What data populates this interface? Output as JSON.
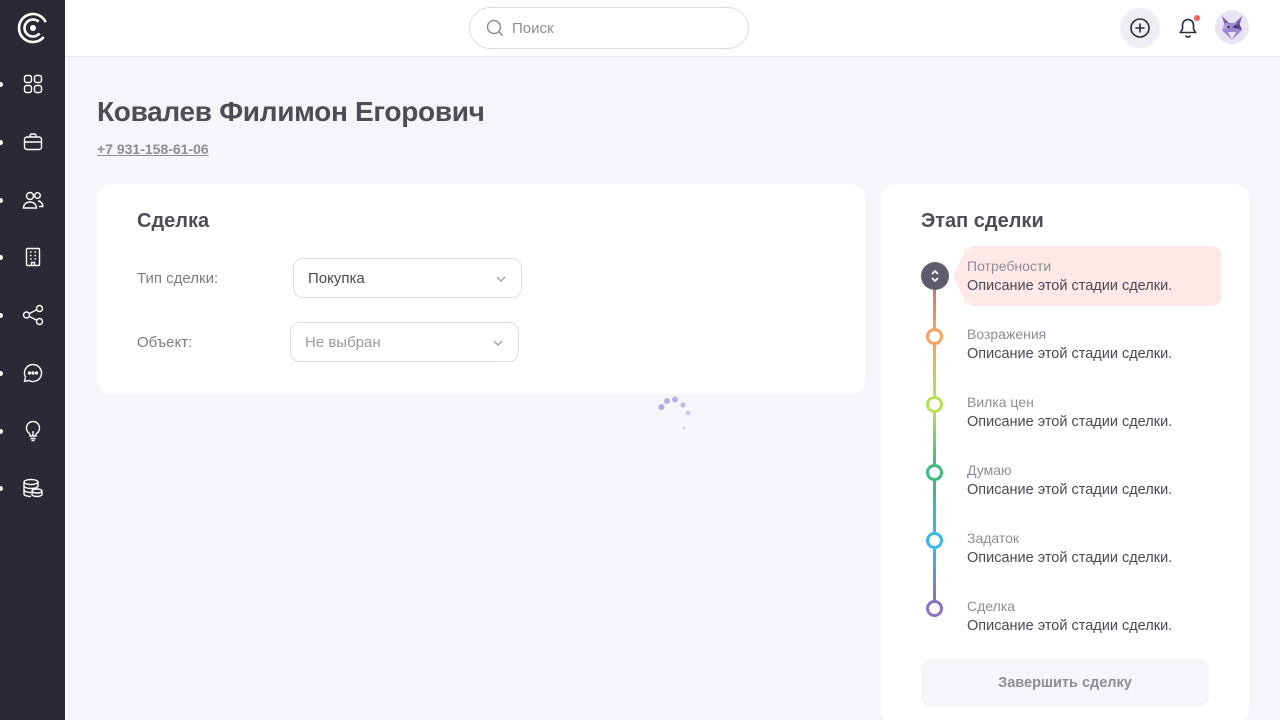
{
  "sidebar": {
    "logo": "logo-icon",
    "items": [
      {
        "icon": "apps-grid-icon"
      },
      {
        "icon": "briefcase-icon"
      },
      {
        "icon": "users-icon"
      },
      {
        "icon": "building-icon"
      },
      {
        "icon": "share-icon"
      },
      {
        "icon": "chat-icon"
      },
      {
        "icon": "lightbulb-icon"
      },
      {
        "icon": "database-icon"
      }
    ]
  },
  "topbar": {
    "search_placeholder": "Поиск",
    "search_icon": "search-icon",
    "add_icon": "plus-circle-icon",
    "bell_icon": "bell-icon",
    "notification_badge_color": "#f2665a"
  },
  "client": {
    "name": "Ковалев Филимон Егорович",
    "phone": "+7 931-158-61-06"
  },
  "deal": {
    "title": "Сделка",
    "type_label": "Тип сделки:",
    "type_value": "Покупка",
    "object_label": "Объект:",
    "object_value": "Не выбран"
  },
  "stages": {
    "title": "Этап сделки",
    "current_index": 0,
    "items": [
      {
        "name": "Потребности",
        "desc": "Описание этой стадии сделки.",
        "color": "#e06d6d"
      },
      {
        "name": "Возражения",
        "desc": "Описание этой стадии сделки.",
        "color": "#f5a263"
      },
      {
        "name": "Вилка цен",
        "desc": "Описание этой стадии сделки.",
        "color": "#b5e05a"
      },
      {
        "name": "Думаю",
        "desc": "Описание этой стадии сделки.",
        "color": "#3fba7d"
      },
      {
        "name": "Задаток",
        "desc": "Описание этой стадии сделки.",
        "color": "#3cb6e6"
      },
      {
        "name": "Сделка",
        "desc": "Описание этой стадии сделки.",
        "color": "#8a72c2"
      }
    ],
    "finish_label": "Завершить сделку"
  },
  "colors": {
    "sidebar_bg": "#2b2935",
    "page_bg": "#f5f5fa",
    "active_stage_bg": "#ffe8e8",
    "spinner": "#b3abe0"
  }
}
